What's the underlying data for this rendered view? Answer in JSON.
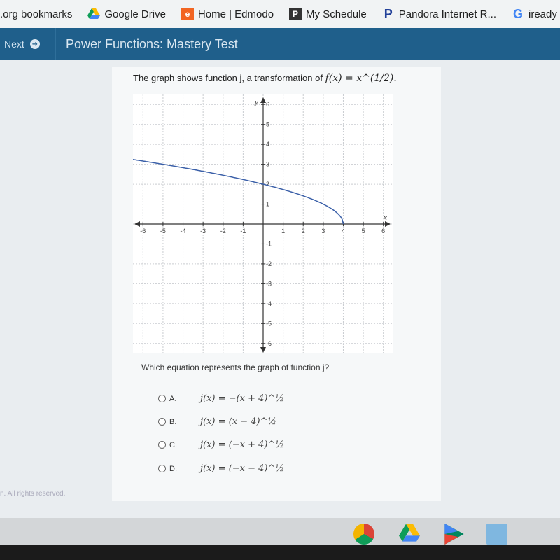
{
  "bookmarks": [
    {
      "label": ".org bookmarks",
      "icon": "none"
    },
    {
      "label": "Google Drive",
      "icon": "google-drive-icon"
    },
    {
      "label": "Home | Edmodo",
      "icon": "edmodo-icon"
    },
    {
      "label": "My Schedule",
      "icon": "schedule-icon"
    },
    {
      "label": "Pandora Internet R...",
      "icon": "pandora-icon"
    },
    {
      "label": "iready - Go",
      "icon": "google-icon"
    }
  ],
  "topbar": {
    "next_label": "Next",
    "title": "Power Functions: Mastery Test"
  },
  "prompt": {
    "text": "The graph shows function j, a transformation of",
    "formula": "f(x) = x^(1/2)."
  },
  "chart_data": {
    "type": "line",
    "title": "",
    "xlabel": "x",
    "ylabel": "y",
    "xlim": [
      -6.5,
      6.5
    ],
    "ylim": [
      -6.5,
      6.5
    ],
    "x_ticks": [
      -6,
      -5,
      -4,
      -3,
      -2,
      -1,
      1,
      2,
      3,
      4,
      5,
      6
    ],
    "y_ticks": [
      -6,
      -5,
      -4,
      -3,
      -2,
      -1,
      1,
      2,
      3,
      4,
      5,
      6
    ],
    "grid": true,
    "series": [
      {
        "name": "j(x)",
        "function": "sqrt(-x+4)",
        "x": [
          -6.5,
          -5,
          -4,
          -2,
          0,
          2,
          3,
          3.75,
          4
        ],
        "y": [
          3.24,
          3.0,
          2.83,
          2.45,
          2.0,
          1.41,
          1.0,
          0.5,
          0.0
        ]
      }
    ],
    "line_color": "#3a5fa8"
  },
  "question": "Which equation represents the graph of function j?",
  "options": [
    {
      "label": "A.",
      "equation": "j(x) = −(x + 4)^½"
    },
    {
      "label": "B.",
      "equation": "j(x) = (x − 4)^½"
    },
    {
      "label": "C.",
      "equation": "j(x) = (−x + 4)^½"
    },
    {
      "label": "D.",
      "equation": "j(x) = (−x − 4)^½"
    }
  ],
  "footer": "n. All rights reserved."
}
